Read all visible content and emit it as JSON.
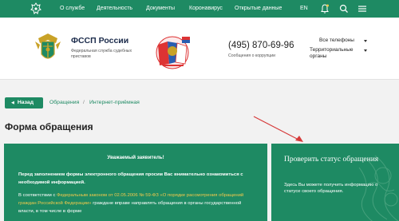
{
  "nav": {
    "items": [
      "О службе",
      "Деятельность",
      "Документы",
      "Коронавирус",
      "Открытые данные"
    ],
    "lang": "EN"
  },
  "header": {
    "org_title": "ФССП России",
    "org_subtitle": "Федеральная служба судебных приставов",
    "phone": "(495) 870-69-96",
    "phone_note": "Сообщения о коррупции",
    "all_phones": "Все телефоны",
    "territorial": "Территориальные органы"
  },
  "breadcrumbs": {
    "back_label": "Назад",
    "items": [
      "Обращения",
      "Интернет-приёмная"
    ],
    "separator": "/"
  },
  "page_title": "Форма обращения",
  "notice": {
    "heading": "Уважаемый заявитель!",
    "paragraph1": "Перед заполнением формы электронного обращения просим Вас внимательно ознакомиться с необходимой информацией.",
    "p2_before": "В соответствии с ",
    "p2_link": "Федеральным законом от 02.05.2006 № 59-ФЗ «О порядке рассмотрения обращений граждан Российской Федерации»",
    "p2_after": " граждане вправе направлять обращения в органы государственной власти, в том числе в форме"
  },
  "status_panel": {
    "title": "Проверить статус обращения",
    "text": "Здесь Вы можете получить информацию о статусе своего обращения."
  },
  "colors": {
    "brand_green": "#1e8a63",
    "link_yellow": "#f2c94c",
    "arrow_red": "#d63a3a"
  },
  "icons": [
    "emblem-icon",
    "bell-icon",
    "search-icon",
    "menu-icon",
    "arrow-left-icon",
    "chevron-down-icon"
  ]
}
